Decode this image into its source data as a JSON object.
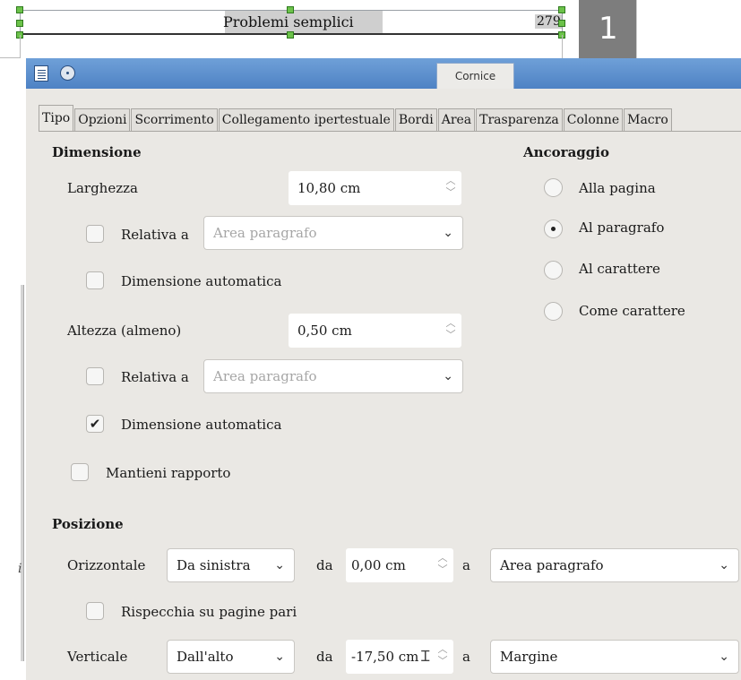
{
  "document": {
    "title": "Problemi semplici",
    "page_ref": "279",
    "page_thumb_number": "1",
    "left_mark": "i"
  },
  "dialog": {
    "title": "Cornice",
    "tabs": [
      "Tipo",
      "Opzioni",
      "Scorrimento",
      "Collegamento ipertestuale",
      "Bordi",
      "Area",
      "Trasparenza",
      "Colonne",
      "Macro"
    ],
    "active_tab": "Tipo",
    "dimensione": {
      "title": "Dimensione",
      "larghezza_label": "Larghezza",
      "larghezza_value": "10,80 cm",
      "relativa1_label": "Relativa a",
      "relativa1_value": "Area paragrafo",
      "auto1_label": "Dimensione automatica",
      "altezza_label": "Altezza (almeno)",
      "altezza_value": "0,50 cm",
      "relativa2_label": "Relativa a",
      "relativa2_value": "Area paragrafo",
      "auto2_label": "Dimensione automatica",
      "mantieni_label": "Mantieni rapporto"
    },
    "ancoraggio": {
      "title": "Ancoraggio",
      "options": [
        "Alla pagina",
        "Al paragrafo",
        "Al carattere",
        "Come carattere"
      ],
      "selected": "Al paragrafo"
    },
    "posizione": {
      "title": "Posizione",
      "orizzontale_label": "Orizzontale",
      "orizzontale_value": "Da sinistra",
      "da_label": "da",
      "orizzontale_offset": "0,00 cm",
      "a_label": "a",
      "orizzontale_ref": "Area paragrafo",
      "rispecchia_label": "Rispecchia su pagine pari",
      "verticale_label": "Verticale",
      "verticale_value": "Dall'alto",
      "verticale_offset": "-17,50 cm",
      "verticale_ref": "Margine"
    }
  },
  "icons": {
    "spin": "spin-up-down-icon",
    "caret": "chevron-down-icon",
    "check": "checkmark-icon"
  }
}
